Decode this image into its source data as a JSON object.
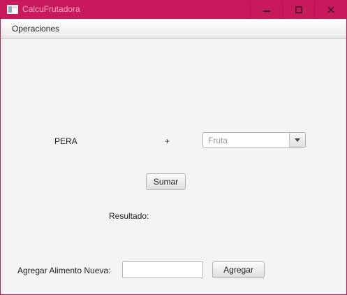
{
  "window": {
    "title": "CalcuFrutadora",
    "accent_color": "#c8195d"
  },
  "menu": {
    "items": [
      {
        "label": "Operaciones"
      }
    ]
  },
  "calc": {
    "operand_left": "PERA",
    "operator": "+",
    "fruit_select": {
      "placeholder": "Fruta"
    },
    "sum_button": "Sumar",
    "result_label": "Resultado:",
    "result_value": ""
  },
  "add_food": {
    "label": "Agregar Alimento Nueva:",
    "input_value": "",
    "button": "Agregar"
  }
}
